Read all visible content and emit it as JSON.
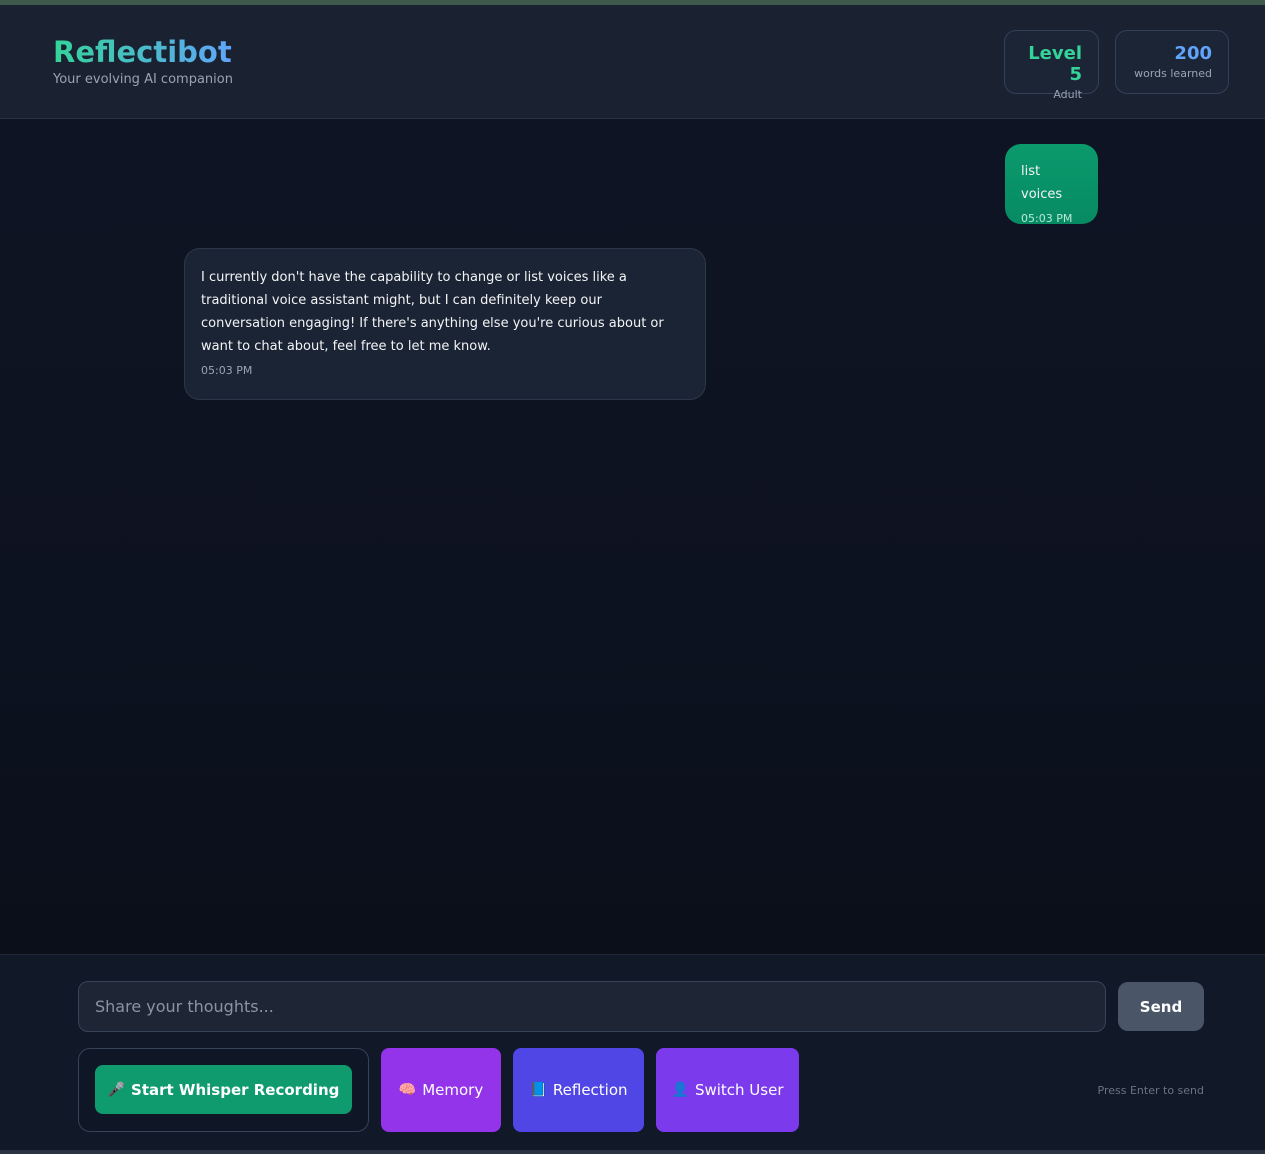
{
  "header": {
    "title": "Reflectibot",
    "subtitle": "Your evolving AI companion",
    "level": {
      "value": "Level 5",
      "label": "Adult"
    },
    "words": {
      "value": "200",
      "label": "words learned"
    }
  },
  "messages": [
    {
      "role": "user",
      "text": "list voices",
      "time": "05:03 PM"
    },
    {
      "role": "bot",
      "text": "I currently don't have the capability to change or list voices like a traditional voice assistant might, but I can definitely keep our conversation engaging! If there's anything else you're curious about or want to chat about, feel free to let me know.",
      "time": "05:03 PM"
    }
  ],
  "composer": {
    "placeholder": "Share your thoughts...",
    "send_label": "Send",
    "record_label": "Start Whisper Recording",
    "record_icon": "microphone-icon",
    "memory_label": "Memory",
    "memory_icon": "brain-icon",
    "reflection_label": "Reflection",
    "reflection_icon": "book-icon",
    "switch_label": "Switch User",
    "switch_icon": "user-icon",
    "hint": "Press Enter to send"
  },
  "colors": {
    "accent_green": "#34d399",
    "accent_blue": "#60a5fa",
    "user_bubble": "#0b9a6c",
    "memory": "#9333ea",
    "reflection": "#4f46e5",
    "switch_user": "#7c3aed"
  }
}
